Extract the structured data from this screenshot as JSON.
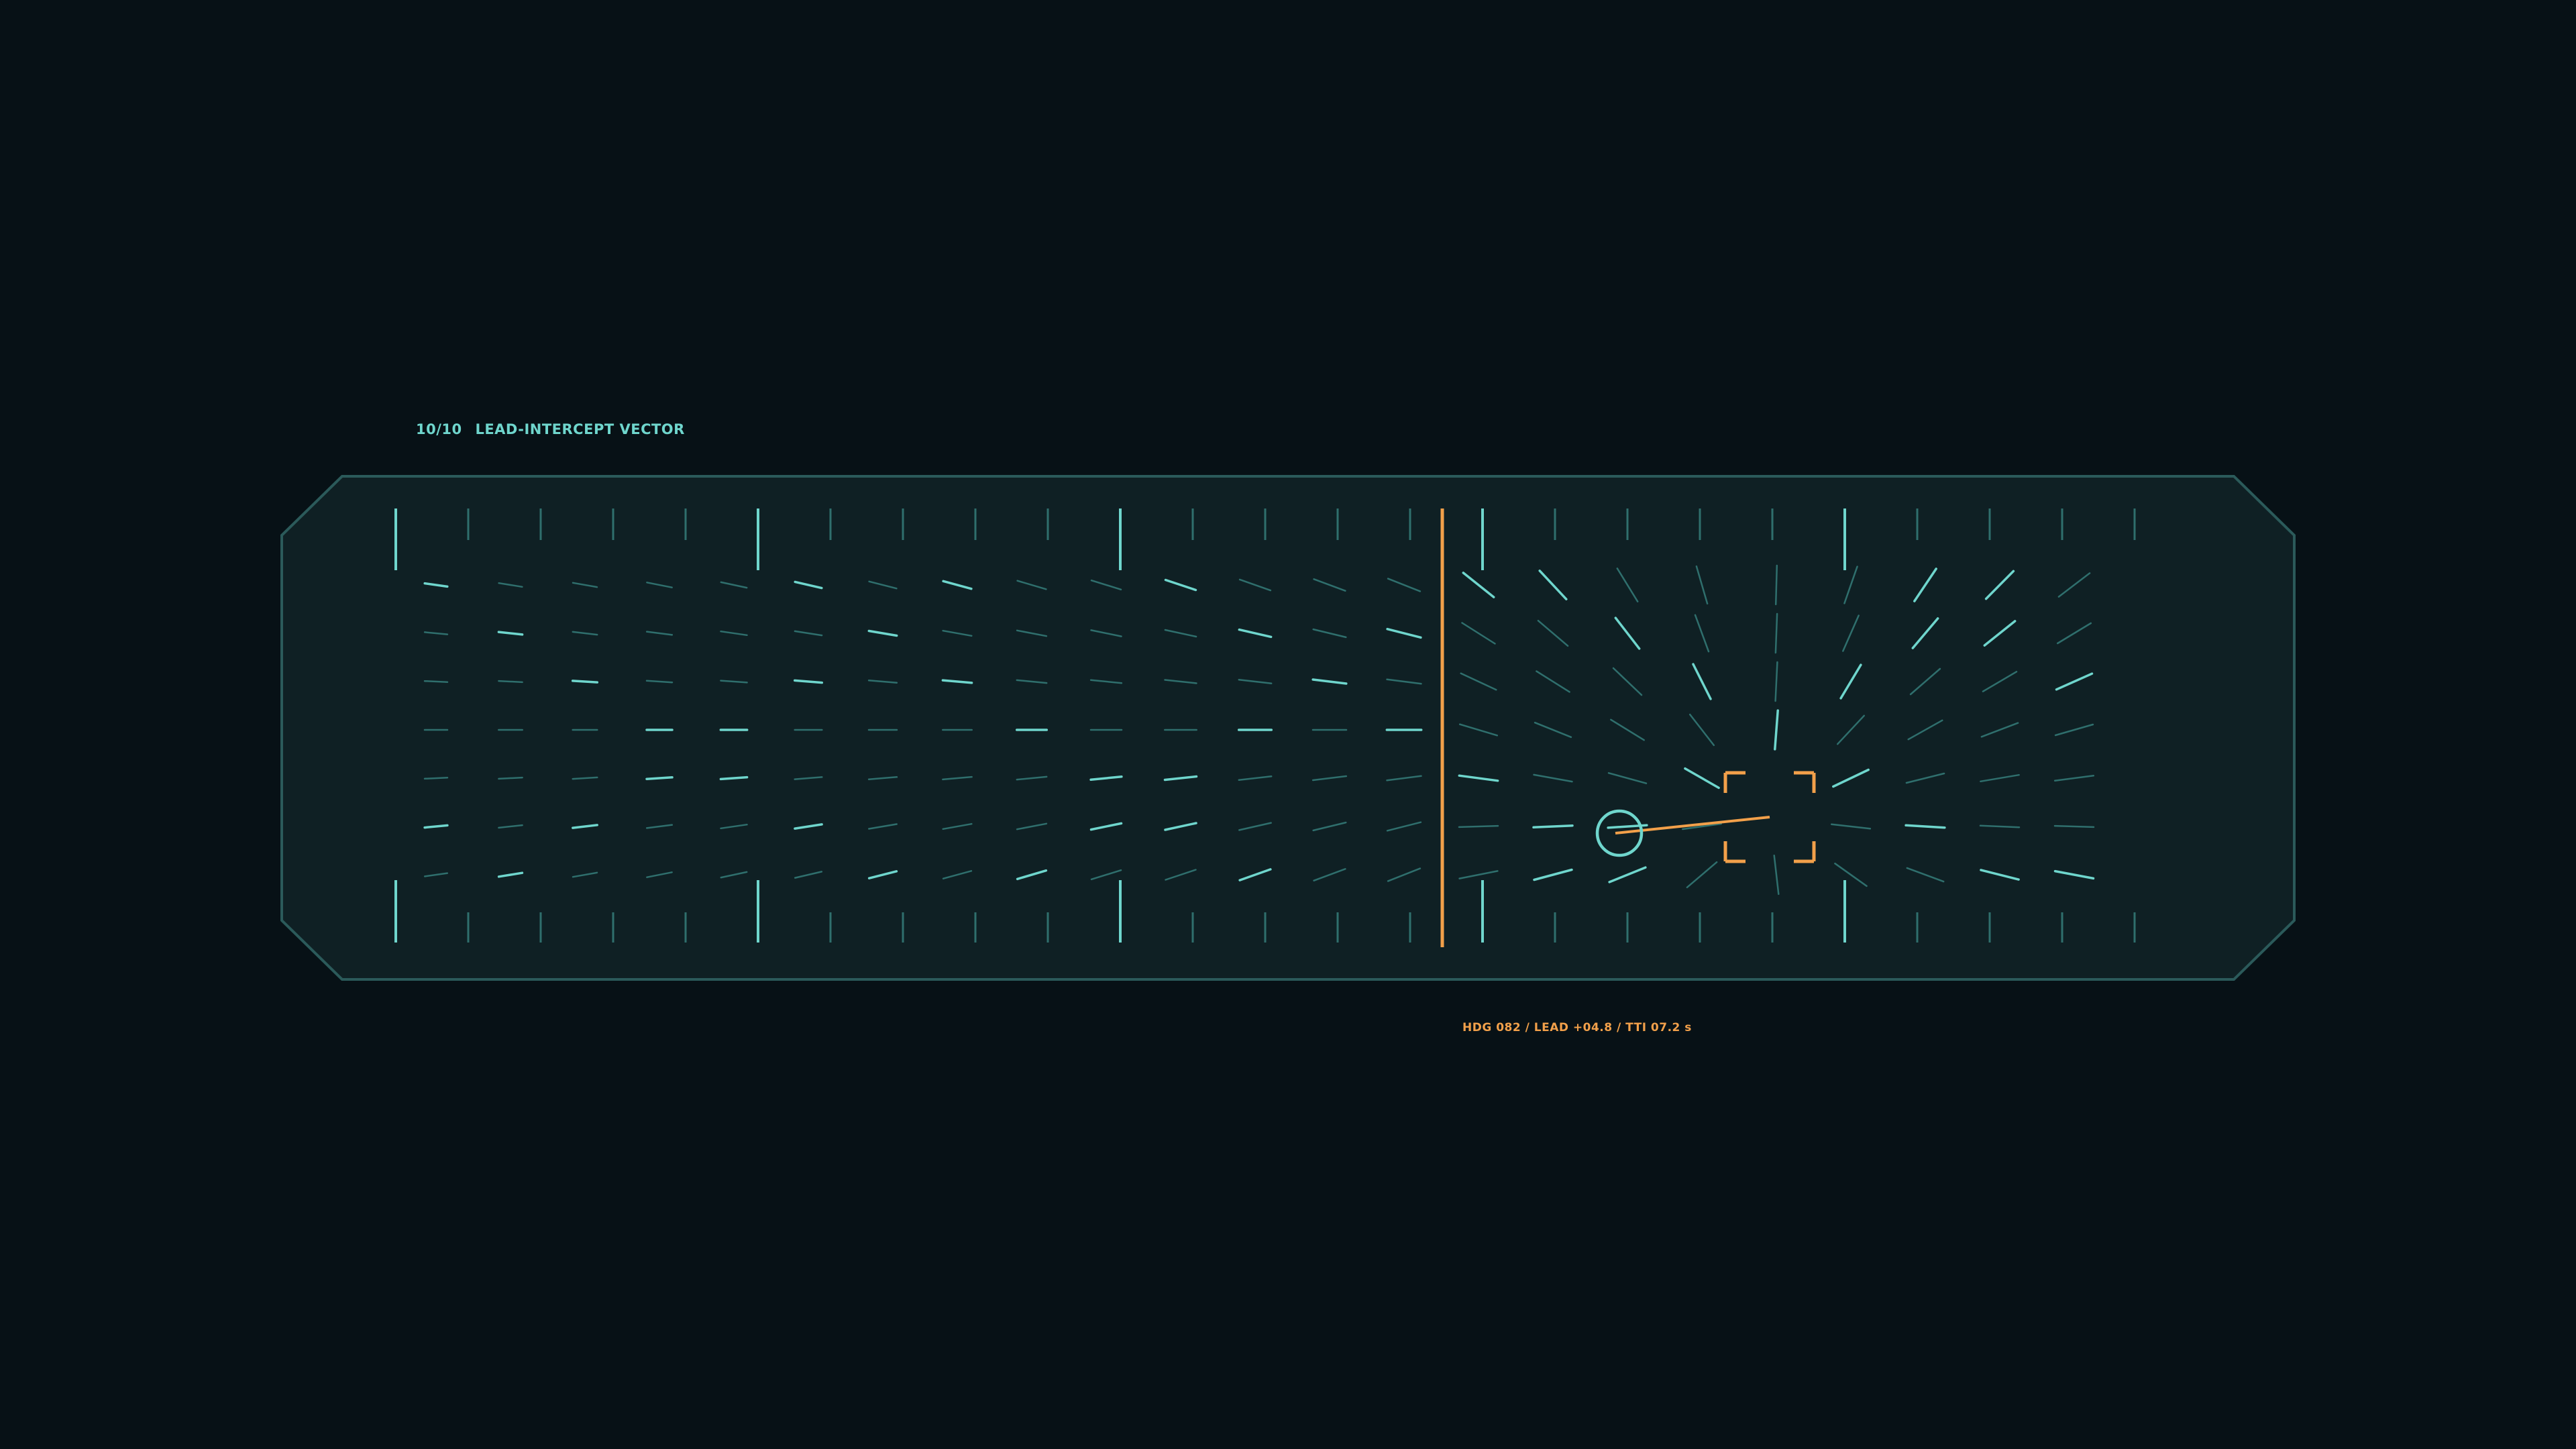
{
  "header": {
    "index": "10/10",
    "title": "LEAD-INTERCEPT VECTOR"
  },
  "readout": {
    "text": "HDG 082 / LEAD +04.8 / TTI 07.2 s"
  },
  "colors": {
    "background": "#071116",
    "panel_fill": "#0f2024",
    "panel_border": "#2b5a5a",
    "accent_cyan": "#6fd6cd",
    "dim_cyan": "#2f6f6d",
    "accent_orange": "#f2a04a"
  },
  "icons": {
    "ownship": "ownship-circle-icon",
    "target": "target-bracket-icon"
  }
}
